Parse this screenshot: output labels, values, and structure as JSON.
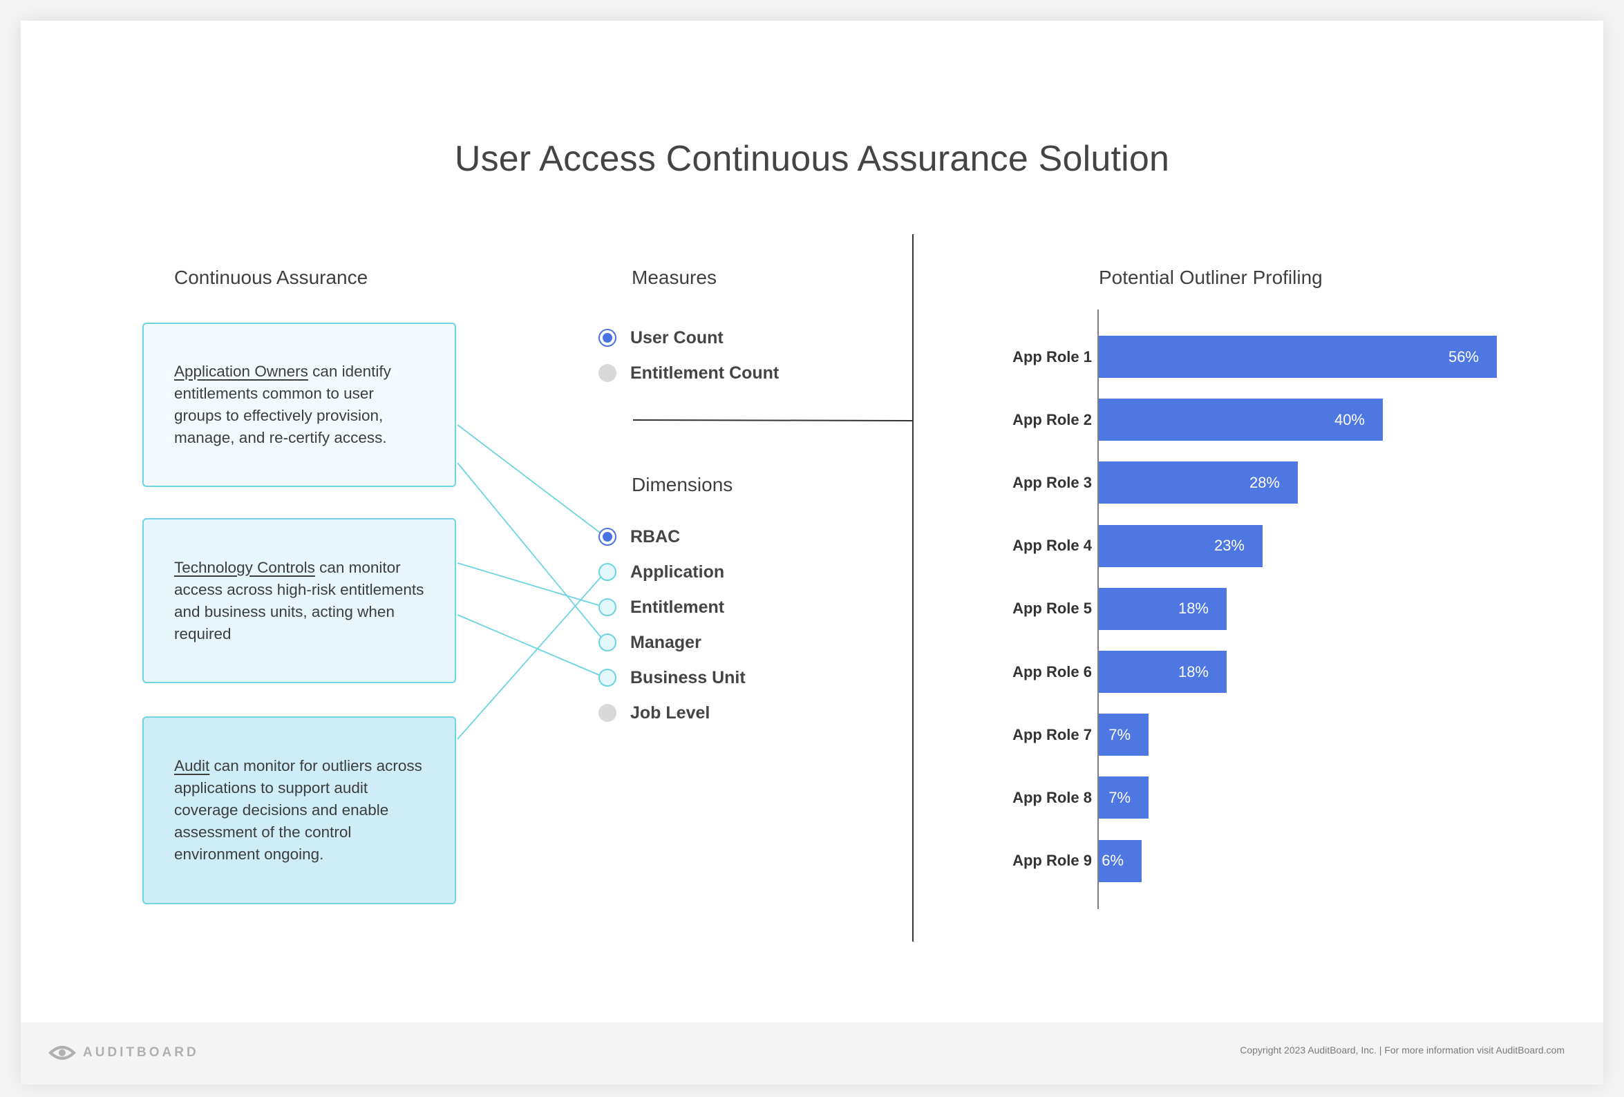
{
  "title": "User Access Continuous Assurance Solution",
  "left": {
    "heading": "Continuous Assurance",
    "boxes": [
      {
        "owner": "Application Owners",
        "text": " can identify entitlements common to user groups to effectively provision, manage, and re-certify access.",
        "bg": "#f3fafe"
      },
      {
        "owner": "Technology Controls",
        "text": " can monitor access across high-risk entitlements and business units, acting when required",
        "bg": "#e6f6fb"
      },
      {
        "owner": "Audit",
        "text": " can monitor for outliers across applications to support audit coverage decisions and enable assessment of the control environment ongoing.",
        "bg": "#cfedf7"
      }
    ]
  },
  "measures": {
    "heading": "Measures",
    "items": [
      {
        "label": "User Count",
        "state": "selected"
      },
      {
        "label": "Entitlement Count",
        "state": "unselected"
      }
    ]
  },
  "dimensions": {
    "heading": "Dimensions",
    "items": [
      {
        "label": "RBAC",
        "state": "selected"
      },
      {
        "label": "Application",
        "state": "linked"
      },
      {
        "label": "Entitlement",
        "state": "linked"
      },
      {
        "label": "Manager",
        "state": "linked"
      },
      {
        "label": "Business Unit",
        "state": "linked"
      },
      {
        "label": "Job Level",
        "state": "unselected"
      }
    ]
  },
  "chart_data": {
    "type": "bar",
    "orientation": "horizontal",
    "title": "Potential Outliner Profiling",
    "categories": [
      "App Role 1",
      "App Role 2",
      "App Role 3",
      "App Role 4",
      "App Role 5",
      "App Role 6",
      "App Role 7",
      "App Role 8",
      "App Role 9"
    ],
    "values": [
      56,
      40,
      28,
      23,
      18,
      18,
      7,
      7,
      6
    ],
    "value_labels": [
      "56%",
      "40%",
      "28%",
      "23%",
      "18%",
      "18%",
      "7%",
      "7%",
      "6%"
    ],
    "bar_color": "#4f77e2",
    "grid": false
  },
  "colors": {
    "accent": "#4a72e0",
    "connector": "#6cd4e2",
    "bar": "#4f77e2"
  },
  "footer": {
    "brand": "AUDITBOARD",
    "copyright": "Copyright 2023 AuditBoard, Inc.   |   For more information visit AuditBoard.com"
  }
}
